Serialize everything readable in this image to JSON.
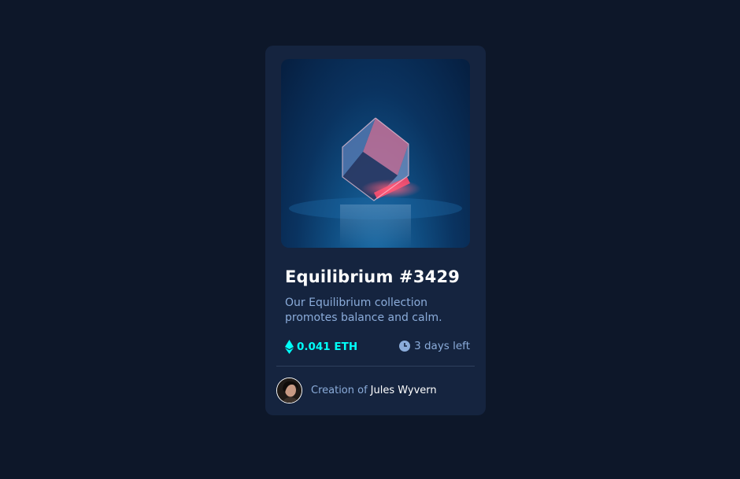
{
  "card": {
    "title": "Equilibrium #3429",
    "description": "Our Equilibrium collection promotes balance and calm.",
    "price": "0.041 ETH",
    "time_left": "3 days left",
    "creation_prefix": "Creation of",
    "creator_name": "Jules Wyvern"
  },
  "icons": {
    "price": "ethereum-icon",
    "time": "clock-icon"
  },
  "colors": {
    "page_bg": "#0d1729",
    "card_bg": "#15243f",
    "accent_cyan": "#00fff8",
    "soft_blue": "#8bacda",
    "white": "#ffffff"
  }
}
